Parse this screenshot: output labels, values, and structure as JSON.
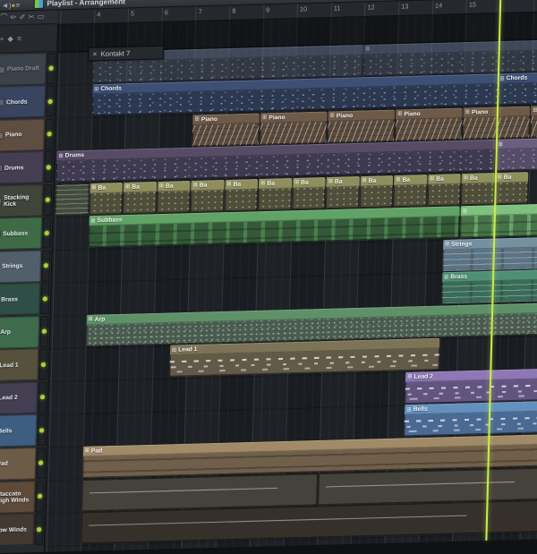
{
  "titlebar": {
    "title": "Playlist - Arrangement"
  },
  "toolbar": {
    "icons": [
      {
        "name": "volume-icon",
        "glyph": "◄)"
      },
      {
        "name": "record-icon",
        "glyph": "●"
      },
      {
        "name": "menu-icon",
        "glyph": "≡"
      }
    ]
  },
  "tools": {
    "icons": [
      {
        "name": "magnet-icon",
        "glyph": "⌒"
      },
      {
        "name": "pencil-icon",
        "glyph": "✏"
      },
      {
        "name": "brush-icon",
        "glyph": "✐"
      },
      {
        "name": "slice-icon",
        "glyph": "✂"
      },
      {
        "name": "select-icon",
        "glyph": "▭"
      }
    ]
  },
  "panel_header": {
    "icons": [
      {
        "name": "add-track-icon",
        "glyph": "+"
      },
      {
        "name": "filter-icon",
        "glyph": "◆"
      },
      {
        "name": "collapse-icon",
        "glyph": "≡"
      }
    ]
  },
  "plugin_window": {
    "close_label": "×",
    "title": "Kontakt 7"
  },
  "ruler": {
    "bars": [
      4,
      5,
      6,
      7,
      8,
      9,
      10,
      11,
      12,
      13,
      14,
      15
    ]
  },
  "playhead": {
    "bar": 16,
    "color": "#c7ea4e"
  },
  "icons": {
    "clip_glyph": "⊞"
  },
  "palette": {
    "chords": {
      "h": "#3e4f75",
      "b": "#2c3850"
    },
    "piano": {
      "h": "#6e5a49",
      "b": "#594a3d"
    },
    "drums": {
      "h": "#564c66",
      "b": "#3f3950"
    },
    "drums2": {
      "h": "#6a5f80",
      "b": "#554c68"
    },
    "ba": {
      "h": "#8f8f5e",
      "b": "#4e4e3a"
    },
    "wave": {
      "h": "#5a6150",
      "b": "#434a3e"
    },
    "subbass": {
      "h": "#61a366",
      "b": "#4a7f50"
    },
    "subbass2": {
      "h": "#7fc07f",
      "b": "#66a468"
    },
    "strings": {
      "h": "#7590a1",
      "b": "#5b7382"
    },
    "brass": {
      "h": "#4f8f76",
      "b": "#3a6b58"
    },
    "arp": {
      "h": "#5f9169",
      "b": "#4b5a4f"
    },
    "lead1": {
      "h": "#7d7457",
      "b": "#615a47"
    },
    "lead2": {
      "h": "#8d77b5",
      "b": "#63547f"
    },
    "bells": {
      "h": "#6390bd",
      "b": "#4a6a94"
    },
    "pad": {
      "h": "#a08a67",
      "b": "#70604b"
    },
    "stac": {
      "h": "#57534a",
      "b": "#45423b"
    },
    "low": {
      "h": "#453c33",
      "b": "#36302a"
    }
  },
  "tracks": [
    {
      "name": "Piano Draft",
      "color": "#3c424a",
      "muted": true
    },
    {
      "name": "Chords",
      "color": "#39455f"
    },
    {
      "name": "Piano",
      "color": "#5d4e41"
    },
    {
      "name": "Drums",
      "color": "#453e52"
    },
    {
      "name": "Stacking Kick",
      "color": "#414438"
    },
    {
      "name": "Subbass",
      "color": "#3e6b46"
    },
    {
      "name": "Strings",
      "color": "#515f6b"
    },
    {
      "name": "Brass",
      "color": "#2f4f46"
    },
    {
      "name": "Arp",
      "color": "#3f6b4d"
    },
    {
      "name": "Lead 1",
      "color": "#55513d"
    },
    {
      "name": "Lead 2",
      "color": "#433e52"
    },
    {
      "name": "Bells",
      "color": "#3d5e80"
    },
    {
      "name": "Pad",
      "color": "#6b5b47"
    },
    {
      "name": "Staccato High Winds",
      "color": "#5d4a3a"
    },
    {
      "name": "Low Winds",
      "color": "#443931"
    }
  ],
  "clips": [
    {
      "row": 0,
      "name": "",
      "start": 4,
      "length": 8,
      "color": "chords",
      "pattern": "dots",
      "muted": true
    },
    {
      "row": 0,
      "name": "",
      "start": 12,
      "length": 6,
      "color": "chords",
      "pattern": "dots",
      "muted": true
    },
    {
      "row": 1,
      "name": "Chords",
      "start": 4,
      "length": 12,
      "color": "chords",
      "pattern": "dots"
    },
    {
      "row": 1,
      "name": "Chords",
      "start": 16,
      "length": 2,
      "color": "chords",
      "pattern": "dots"
    },
    {
      "row": 2,
      "name": "Piano",
      "start": 7,
      "length": 2,
      "color": "piano",
      "pattern": "slashes"
    },
    {
      "row": 2,
      "name": "Piano",
      "start": 9,
      "length": 2,
      "color": "piano",
      "pattern": "slashes"
    },
    {
      "row": 2,
      "name": "Piano",
      "start": 11,
      "length": 2,
      "color": "piano",
      "pattern": "slashes"
    },
    {
      "row": 2,
      "name": "Piano",
      "start": 13,
      "length": 2,
      "color": "piano",
      "pattern": "slashes"
    },
    {
      "row": 2,
      "name": "Piano",
      "start": 15,
      "length": 2,
      "color": "piano",
      "pattern": "slashes"
    },
    {
      "row": 2,
      "name": "Piano",
      "start": 17,
      "length": 2,
      "color": "piano",
      "pattern": "slashes"
    },
    {
      "row": 3,
      "name": "Drums",
      "start": 3,
      "length": 13,
      "color": "drums",
      "pattern": "dots"
    },
    {
      "row": 3,
      "name": "",
      "start": 16,
      "length": 2,
      "color": "drums2",
      "pattern": "dots"
    },
    {
      "row": 4,
      "name": "",
      "start": 3,
      "length": 1,
      "color": "wave",
      "pattern": "wave",
      "nohead": true
    },
    {
      "row": 4,
      "name": "Ba",
      "start": 4,
      "length": 1,
      "color": "ba",
      "pattern": "mini"
    },
    {
      "row": 4,
      "name": "Ba",
      "start": 5,
      "length": 1,
      "color": "ba",
      "pattern": "mini"
    },
    {
      "row": 4,
      "name": "Ba",
      "start": 6,
      "length": 1,
      "color": "ba",
      "pattern": "mini"
    },
    {
      "row": 4,
      "name": "Ba",
      "start": 7,
      "length": 1,
      "color": "ba",
      "pattern": "mini"
    },
    {
      "row": 4,
      "name": "Ba",
      "start": 8,
      "length": 1,
      "color": "ba",
      "pattern": "mini"
    },
    {
      "row": 4,
      "name": "Ba",
      "start": 9,
      "length": 1,
      "color": "ba",
      "pattern": "mini"
    },
    {
      "row": 4,
      "name": "Ba",
      "start": 10,
      "length": 1,
      "color": "ba",
      "pattern": "mini"
    },
    {
      "row": 4,
      "name": "Ba",
      "start": 11,
      "length": 1,
      "color": "ba",
      "pattern": "mini"
    },
    {
      "row": 4,
      "name": "Ba",
      "start": 12,
      "length": 1,
      "color": "ba",
      "pattern": "mini"
    },
    {
      "row": 4,
      "name": "Ba",
      "start": 13,
      "length": 1,
      "color": "ba",
      "pattern": "mini"
    },
    {
      "row": 4,
      "name": "Ba",
      "start": 14,
      "length": 1,
      "color": "ba",
      "pattern": "mini"
    },
    {
      "row": 4,
      "name": "Ba",
      "start": 15,
      "length": 1,
      "color": "ba",
      "pattern": "mini"
    },
    {
      "row": 4,
      "name": "Ba",
      "start": 16,
      "length": 1,
      "color": "ba",
      "pattern": "mini"
    },
    {
      "row": 5,
      "name": "Subbass",
      "start": 4,
      "length": 11,
      "color": "subbass",
      "pattern": "basslines"
    },
    {
      "row": 5,
      "name": "",
      "start": 15,
      "length": 3,
      "color": "subbass2",
      "pattern": "basslines"
    },
    {
      "row": 6,
      "name": "Strings",
      "start": 14.5,
      "length": 3.5,
      "color": "strings",
      "pattern": "longlines"
    },
    {
      "row": 7,
      "name": "Brass",
      "start": 14.5,
      "length": 3.5,
      "color": "brass",
      "pattern": "longlines"
    },
    {
      "row": 8,
      "name": "Arp",
      "start": 4,
      "length": 14,
      "color": "arp",
      "pattern": "dotsdense"
    },
    {
      "row": 9,
      "name": "Lead 1",
      "start": 6.5,
      "length": 8,
      "color": "lead1",
      "pattern": "melody"
    },
    {
      "row": 10,
      "name": "Lead 2",
      "start": 13.5,
      "length": 4.5,
      "color": "lead2",
      "pattern": "melody"
    },
    {
      "row": 11,
      "name": "Bells",
      "start": 13.5,
      "length": 4.5,
      "color": "bells",
      "pattern": "melody"
    },
    {
      "row": 12,
      "name": "Pad",
      "start": 4,
      "length": 14,
      "color": "pad",
      "pattern": "padlines"
    },
    {
      "row": 13,
      "name": "",
      "start": 4,
      "length": 7,
      "color": "stac",
      "pattern": "thin",
      "nohead": true
    },
    {
      "row": 13,
      "name": "",
      "start": 11,
      "length": 7,
      "color": "stac",
      "pattern": "thin",
      "nohead": true
    },
    {
      "row": 14,
      "name": "",
      "start": 4,
      "length": 14,
      "color": "low",
      "pattern": "thin",
      "nohead": true
    }
  ]
}
